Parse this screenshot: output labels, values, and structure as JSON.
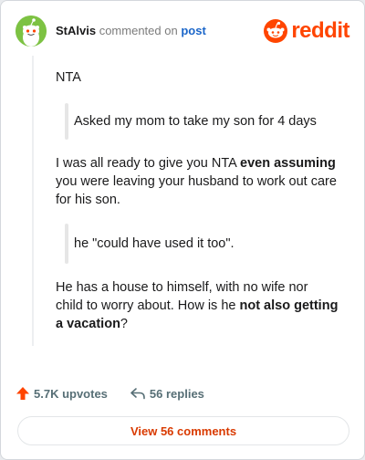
{
  "header": {
    "username": "StAlvis",
    "action_text": "commented on",
    "post_link": "post",
    "brand": "reddit"
  },
  "comment": {
    "line1": "NTA",
    "quote1": "Asked my mom to take my son for 4 days",
    "para2": {
      "pre": "I was all ready to give you NTA ",
      "bold": "even assuming",
      "post": " you were leaving your husband to work out care for his son."
    },
    "quote2": "he \"could have used it too\".",
    "para3": {
      "pre": "He has a house to himself, with no wife nor child to worry about. How is he ",
      "bold": "not also getting a vacation",
      "post": "?"
    }
  },
  "footer": {
    "upvotes": "5.7K upvotes",
    "replies": "56 replies"
  },
  "view_comments": "View 56 comments",
  "colors": {
    "brand": "#ff4500",
    "link": "#1b66c9",
    "avatar": "#7dc243",
    "view_button_text": "#d93a00"
  }
}
